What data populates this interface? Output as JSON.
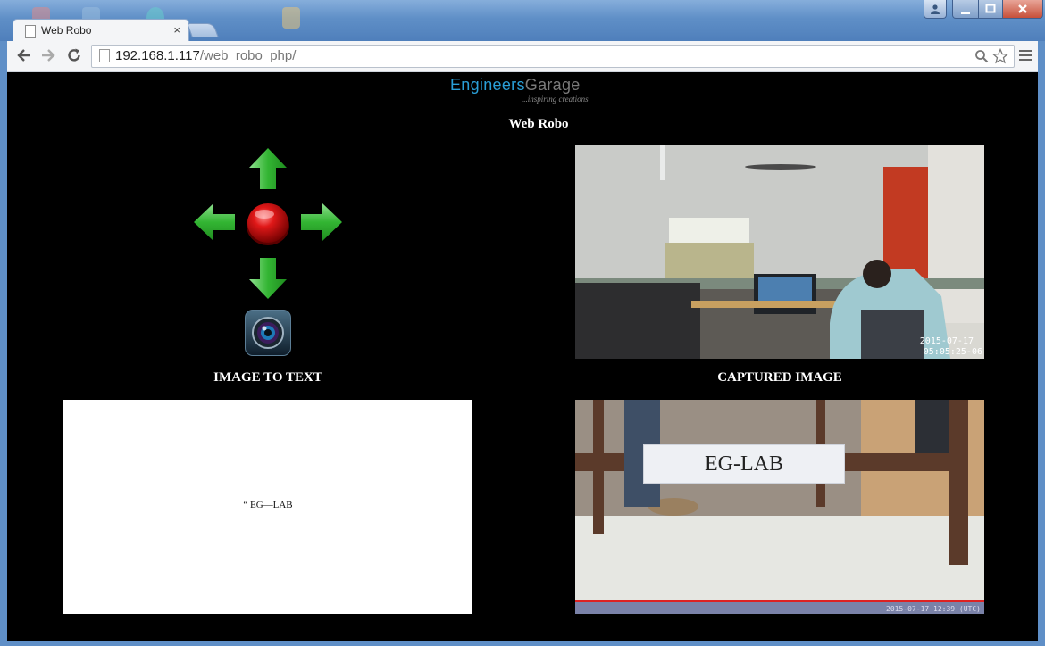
{
  "browser": {
    "tab_title": "Web Robo",
    "tab_close": "×",
    "url_host": "192.168.1.117",
    "url_path": "/web_robo_php/"
  },
  "page": {
    "logo": {
      "part1": "Engineers",
      "part2": "Garage",
      "tagline": "...inspiring creations"
    },
    "title": "Web Robo",
    "image_to_text_label": "IMAGE TO TEXT",
    "captured_image_label": "CAPTURED IMAGE",
    "ocr_text": "“ EG—LAB",
    "live_feed": {
      "date": "2015-07-17",
      "time": "05:05:25-06"
    },
    "captured": {
      "sign_text": "EG-LAB",
      "footer": "2015-07-17 12:39 (UTC)"
    }
  },
  "colors": {
    "arrow_green": "#3cbf3c",
    "stop_red": "#d41010",
    "logo_blue": "#2a9fd8",
    "page_background": "#000000"
  },
  "icons": [
    "back-icon",
    "forward-icon",
    "reload-icon",
    "page-icon",
    "search-icon",
    "star-icon",
    "menu-icon",
    "arrow-up-icon",
    "arrow-down-icon",
    "arrow-left-icon",
    "arrow-right-icon",
    "stop-icon",
    "camera-icon"
  ]
}
